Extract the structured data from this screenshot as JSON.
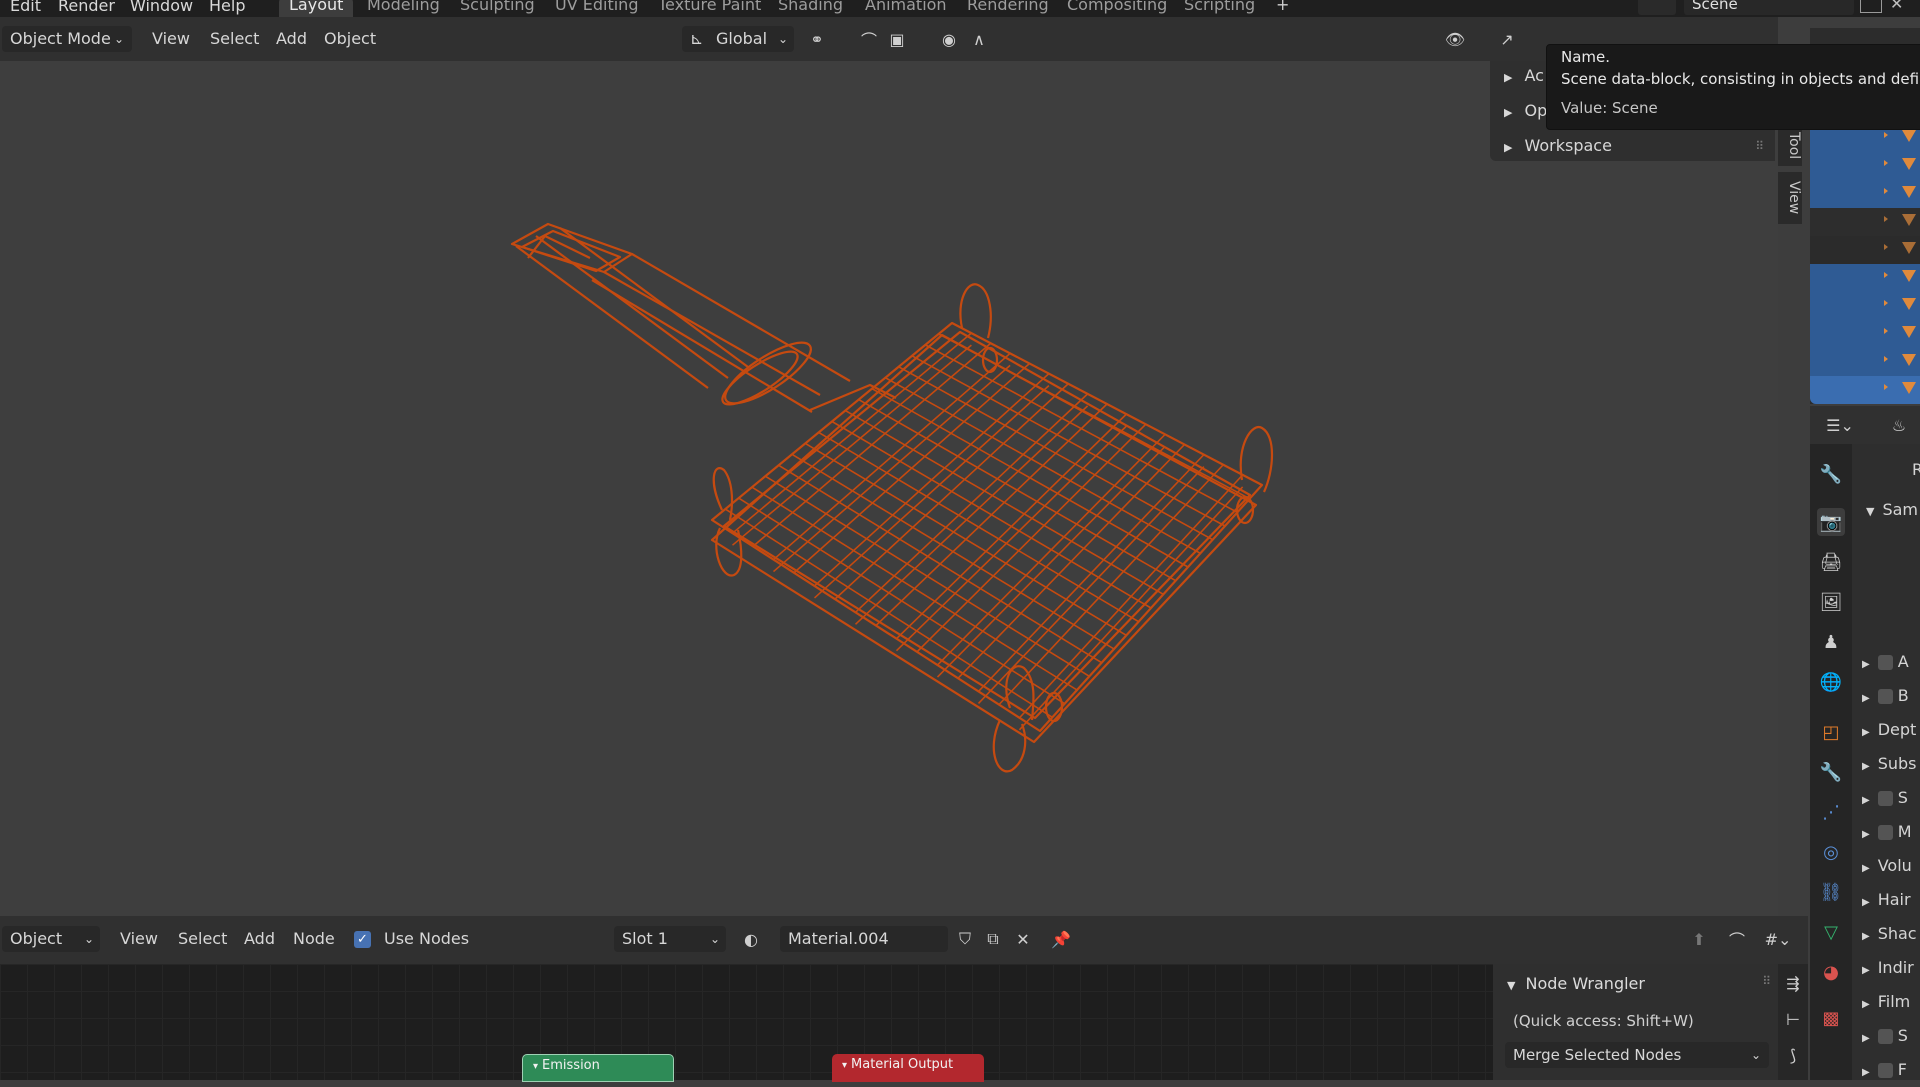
{
  "menubar": {
    "menus": [
      "Edit",
      "Render",
      "Window",
      "Help"
    ],
    "workspaces": [
      "Layout",
      "Modeling",
      "Sculpting",
      "UV Editing",
      "Texture Paint",
      "Shading",
      "Animation",
      "Rendering",
      "Compositing",
      "Scripting"
    ],
    "add_tab": "+",
    "scene_name": "Scene"
  },
  "viewport_header": {
    "mode": "Object Mode",
    "menus": [
      "View",
      "Select",
      "Add",
      "Object"
    ],
    "transform_orientation": "Global"
  },
  "npanel": {
    "rows": [
      "Ac",
      "Op",
      "Workspace"
    ],
    "tabs": [
      "Tool",
      "View"
    ]
  },
  "tooltip": {
    "title": "Name.",
    "description": "Scene data-block, consisting in objects and defining",
    "value": "Value: Scene"
  },
  "properties": {
    "panel_title": "Sam",
    "header_letter": "R",
    "rows": [
      {
        "label": "A",
        "checkbox": true
      },
      {
        "label": "B",
        "checkbox": true
      },
      {
        "label": "Dept",
        "checkbox": false
      },
      {
        "label": "Subs",
        "checkbox": false
      },
      {
        "label": "S",
        "checkbox": true
      },
      {
        "label": "M",
        "checkbox": true
      },
      {
        "label": "Volu",
        "checkbox": false
      },
      {
        "label": "Hair",
        "checkbox": false
      },
      {
        "label": "Shac",
        "checkbox": false
      },
      {
        "label": "Indir",
        "checkbox": false
      },
      {
        "label": "Film",
        "checkbox": false
      },
      {
        "label": "S",
        "checkbox": true
      },
      {
        "label": "F",
        "checkbox": true
      }
    ]
  },
  "node_editor": {
    "editor_type": "Object",
    "menus": [
      "View",
      "Select",
      "Add",
      "Node"
    ],
    "use_nodes_label": "Use Nodes",
    "use_nodes_checked": true,
    "slot": "Slot 1",
    "material": "Material.004",
    "nodes": [
      {
        "label": "Emission",
        "color": "#2e8b57"
      },
      {
        "label": "Material Output",
        "color": "#b3282e"
      }
    ],
    "side_panel": {
      "title": "Node Wrangler",
      "hint": "(Quick access: Shift+W)",
      "dropdown": "Merge Selected Nodes"
    }
  },
  "colors": {
    "wireframe": "#c54a10",
    "selection_blue": "#2f5b94",
    "active_tab": "#3d3d3d",
    "checkbox_blue": "#4772b3"
  }
}
